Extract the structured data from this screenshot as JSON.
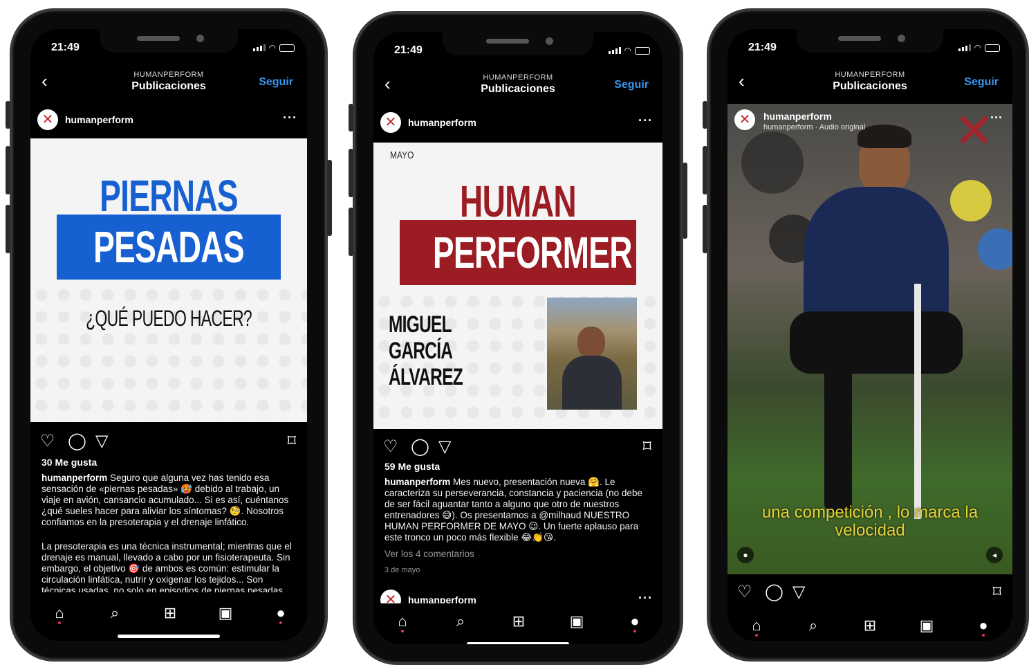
{
  "colors": {
    "follow": "#3897f0",
    "brand_red": "#9c1c24",
    "brand_blue": "#1760d2"
  },
  "common": {
    "time": "21:49",
    "header_sub": "HUMANPERFORM",
    "header_title": "Publicaciones",
    "follow": "Seguir",
    "username": "humanperform",
    "more": "···"
  },
  "post1": {
    "title_line1": "PIERNAS",
    "title_line2": "PESADAS",
    "question": "¿QUÉ PUEDO HACER?",
    "likes": "30 Me gusta",
    "caption_user": "humanperform",
    "caption_text": " Seguro que alguna vez has tenido esa sensación de «piernas pesadas» 🥵 debido al trabajo, un viaje en avión, cansancio acumulado... Si es así, cuéntanos ¿qué sueles hacer para aliviar los síntomas? 🧐. Nosotros confiamos en la presoterapia y el drenaje linfático.",
    "caption_text2": "La presoterapia es una técnica instrumental; mientras que el drenaje es manual, llevado a cabo por un fisioterapeuta. Sin embargo, el objetivo 🎯 de ambos es común: estimular la circulación linfática, nutrir y oxigenar los tejidos... Son técnicas usadas, no solo en episodios de piernas pesadas,"
  },
  "post2": {
    "month": "MAYO",
    "title_line1": "HUMAN",
    "title_line2": "PERFORMER",
    "name_line1": "MIGUEL",
    "name_line2": "GARCÍA",
    "name_line3": "ÁLVAREZ",
    "likes": "59 Me gusta",
    "caption_user": "humanperform",
    "caption_text": " Mes nuevo, presentación nueva 🤗. Le caracteriza su perseverancia, constancia y paciencia (no debe de ser fácil aguantar tanto a alguno que otro de nuestros entrenadores 😅). Os presentamos a @milhaud NUESTRO HUMAN PERFORMER DE MAYO 😉. Un fuerte aplauso para este tronco un poco más flexible 😂👏😘.",
    "comments": "Ver los 4 comentarios",
    "date": "3 de mayo",
    "next_user": "humanperform"
  },
  "post3": {
    "audio": "humanperform · Audio original",
    "subtitle_line1": "una competición , lo marca la",
    "subtitle_line2": "velocidad"
  },
  "icons": {
    "back": "chevron-left-icon",
    "like": "heart-icon",
    "comment": "comment-icon",
    "share": "send-icon",
    "save": "bookmark-icon",
    "home": "home-icon",
    "search": "search-icon",
    "add": "add-icon",
    "reels": "reels-icon",
    "profile": "profile-icon"
  }
}
